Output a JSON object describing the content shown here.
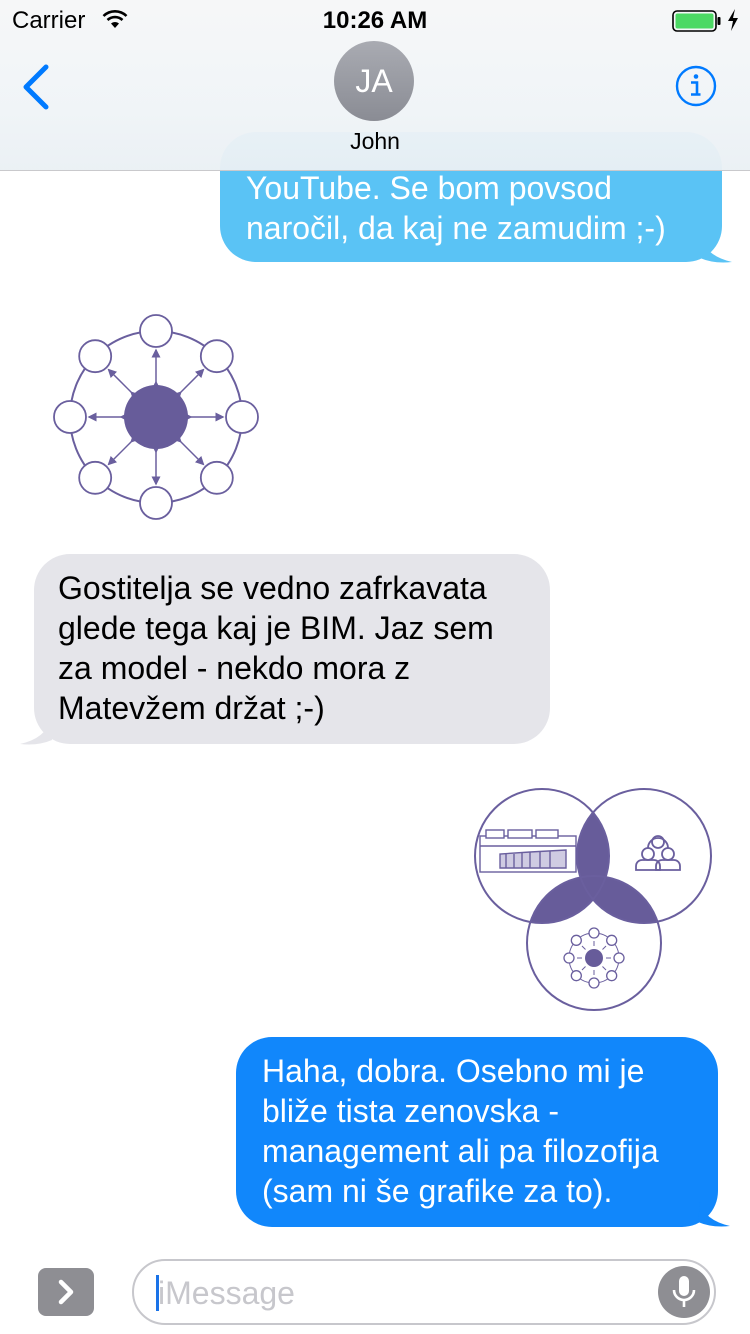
{
  "status_bar": {
    "carrier": "Carrier",
    "time": "10:26 AM",
    "icons": [
      "wifi-icon",
      "battery-icon",
      "charging-bolt-icon"
    ],
    "battery_color": "#4cd964"
  },
  "nav": {
    "back_icon": "chevron-left-icon",
    "avatar_initials": "JA",
    "contact_name": "John",
    "info_icon": "info-icon",
    "accent_color": "#007aff"
  },
  "messages": [
    {
      "direction": "outgoing",
      "text": "YouTube. Se bom povsod\nnaročil, da kaj ne zamudim ;-)",
      "color": "#5ac3f5"
    },
    {
      "direction": "incoming",
      "type": "image",
      "image": "network-diagram"
    },
    {
      "direction": "incoming",
      "text": "Gostitelja se vedno zafrkavata\nglede tega kaj je BIM. Jaz sem\nza model - nekdo mora z\nMatevžem držat ;-)",
      "color": "#e5e5ea"
    },
    {
      "direction": "outgoing",
      "type": "image",
      "image": "venn-diagram"
    },
    {
      "direction": "outgoing",
      "text": "Haha, dobra. Osebno mi je\nbliže tista zenovska -\nmanagement ali pa filozofija\n(sam ni še grafike za to).",
      "color": "#1187fb"
    }
  ],
  "input": {
    "expand_icon": "chevron-right-icon",
    "placeholder": "iMessage",
    "mic_icon": "microphone-icon"
  }
}
